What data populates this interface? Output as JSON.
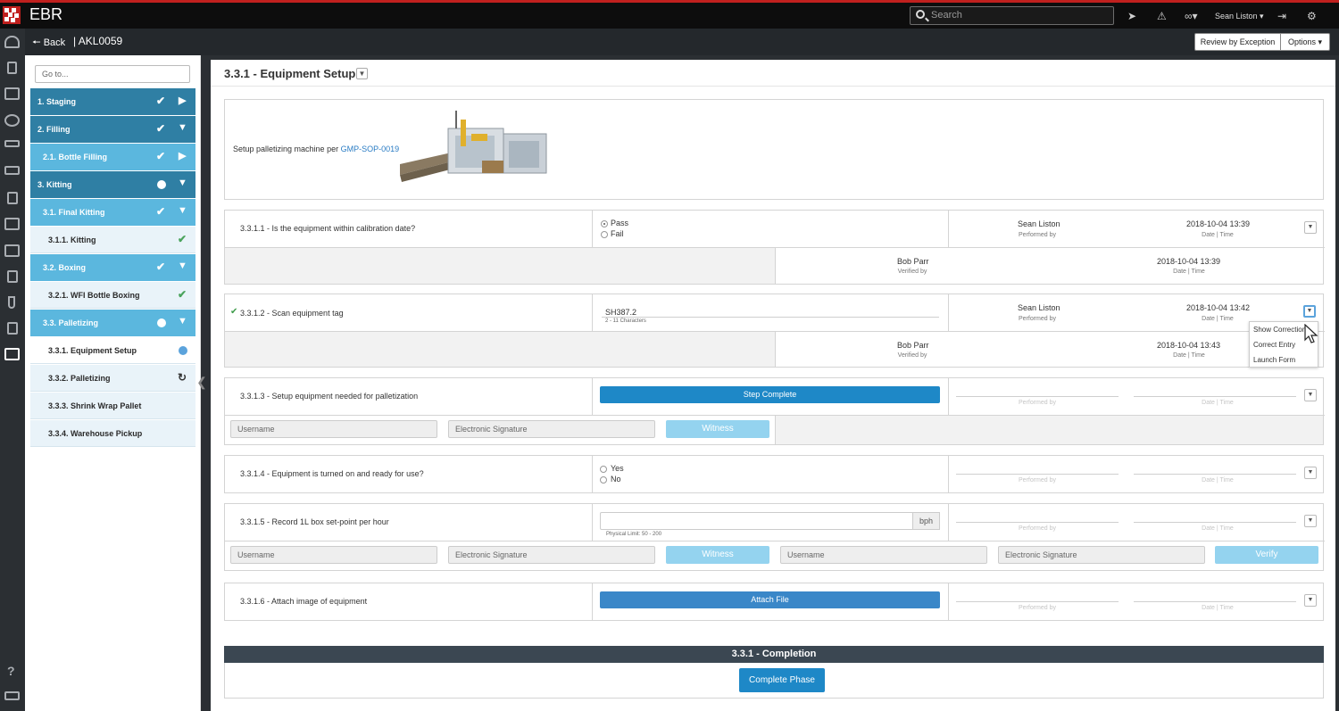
{
  "app": {
    "title": "EBR"
  },
  "topbar": {
    "search_placeholder": "Search",
    "user": "Sean Liston",
    "icons": [
      "location-arrow-icon",
      "warning-icon",
      "link-icon",
      "sign-out-icon",
      "gear-icon"
    ]
  },
  "subbar": {
    "back_label": "Back",
    "batch_id": "| AKL0059",
    "review_label": "Review by Exception",
    "options_label": "Options"
  },
  "nav": {
    "goto_placeholder": "Go to...",
    "items": [
      {
        "label": "1.  Staging",
        "level": 1,
        "status": "complete",
        "toggle": "collapsed"
      },
      {
        "label": "2.  Filling",
        "level": 1,
        "status": "complete",
        "toggle": "expanded"
      },
      {
        "label": "2.1.  Bottle Filling",
        "level": 2,
        "status": "complete",
        "toggle": "collapsed"
      },
      {
        "label": "3.  Kitting",
        "level": 1,
        "status": "in-progress",
        "toggle": "expanded"
      },
      {
        "label": "3.1.  Final Kitting",
        "level": 2,
        "status": "complete",
        "toggle": "expanded"
      },
      {
        "label": "3.1.1.  Kitting",
        "level": 3,
        "status": "complete"
      },
      {
        "label": "3.2.  Boxing",
        "level": 2,
        "status": "complete",
        "toggle": "expanded"
      },
      {
        "label": "3.2.1.  WFI Bottle Boxing",
        "level": 3,
        "status": "complete"
      },
      {
        "label": "3.3.  Palletizing",
        "level": 2,
        "status": "in-progress",
        "toggle": "expanded"
      },
      {
        "label": "3.3.1.  Equipment Setup",
        "level": 3,
        "status": "current"
      },
      {
        "label": "3.3.2.  Palletizing",
        "level": 3,
        "status": "pending-sync"
      },
      {
        "label": "3.3.3.  Shrink Wrap Pallet",
        "level": 3,
        "status": "none"
      },
      {
        "label": "3.3.4.  Warehouse Pickup",
        "level": 3,
        "status": "none"
      }
    ]
  },
  "page": {
    "title": "3.3.1 - Equipment Setup",
    "instruction_text": "Setup palletizing machine per ",
    "instruction_link": "GMP-SOP-0019",
    "labels": {
      "performed_by": "Performed by",
      "verified_by": "Verified by",
      "date_time": "Date | Time",
      "username": "Username",
      "signature": "Electronic Signature",
      "witness": "Witness",
      "verify": "Verify"
    },
    "steps": {
      "s1": {
        "label": "3.3.1.1 - Is the equipment within calibration date?",
        "options": [
          "Pass",
          "Fail"
        ],
        "selected": "Pass",
        "performed_by": "Sean Liston",
        "performed_at": "2018-10-04 13:39",
        "verified_by": "Bob Parr",
        "verified_at": "2018-10-04 13:39"
      },
      "s2": {
        "label": "3.3.1.2 - Scan equipment tag",
        "value": "SH387.2",
        "hint": "2 - 11 Characters",
        "performed_by": "Sean Liston",
        "performed_at": "2018-10-04 13:42",
        "verified_by": "Bob Parr",
        "verified_at": "2018-10-04 13:43",
        "menu": [
          "Show Correction",
          "Correct Entry",
          "Launch Form"
        ]
      },
      "s3": {
        "label": "3.3.1.3 - Setup equipment needed for palletization",
        "button": "Step Complete"
      },
      "s4": {
        "label": "3.3.1.4 - Equipment is turned on and ready for use?",
        "options": [
          "Yes",
          "No"
        ]
      },
      "s5": {
        "label": "3.3.1.5 - Record 1L box set-point per hour",
        "unit": "bph",
        "hint": "Physical Limit: 50 - 200"
      },
      "s6": {
        "label": "3.3.1.6 - Attach image of equipment",
        "button": "Attach File"
      }
    },
    "completion": {
      "title": "3.3.1 - Completion",
      "button": "Complete Phase"
    }
  },
  "colors": {
    "brand_red": "#c0201e",
    "nav_level1": "#2f7fa4",
    "nav_level2": "#5bb7de",
    "primary_button": "#1e88c7",
    "disabled_button": "#94d3ef"
  }
}
